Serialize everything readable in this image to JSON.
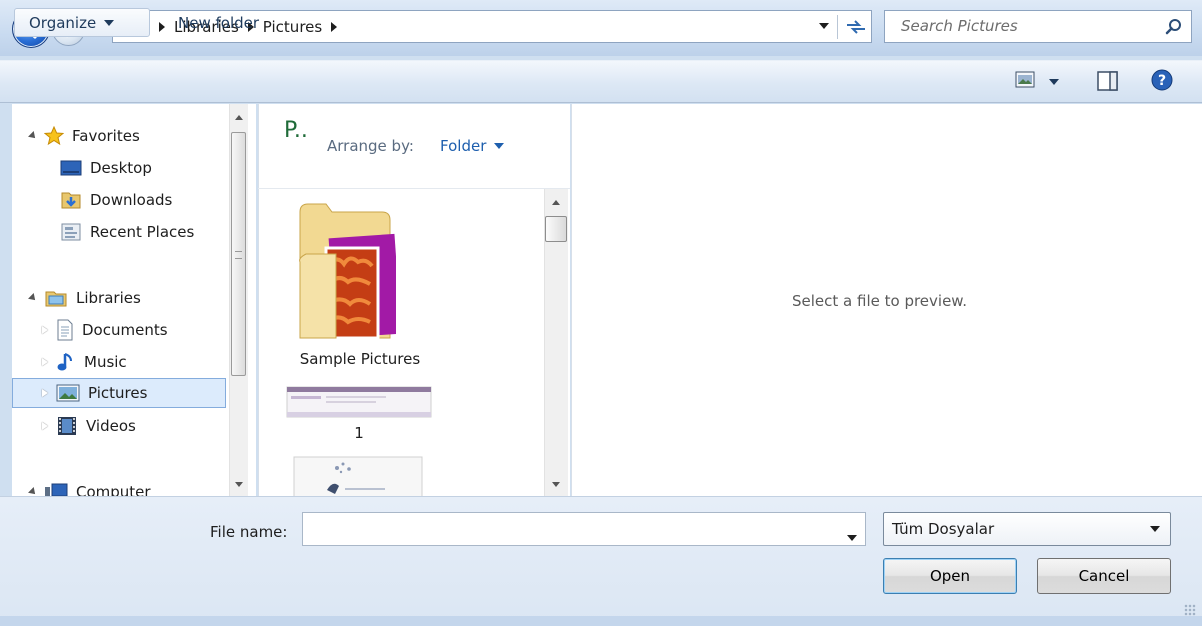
{
  "address": {
    "crumbs": [
      "Libraries",
      "Pictures"
    ]
  },
  "search": {
    "placeholder": "Search Pictures"
  },
  "toolbar": {
    "organize_label": "Organize",
    "new_folder_label": "New folder"
  },
  "nav": {
    "favorites_label": "Favorites",
    "desktop_label": "Desktop",
    "downloads_label": "Downloads",
    "recent_label": "Recent Places",
    "libraries_label": "Libraries",
    "documents_label": "Documents",
    "music_label": "Music",
    "pictures_label": "Pictures",
    "videos_label": "Videos",
    "computer_label": "Computer"
  },
  "file_pane": {
    "library_heading": "P..",
    "arrange_label": "Arrange by:",
    "arrange_value": "Folder",
    "items": [
      {
        "label": "Sample Pictures"
      },
      {
        "label": "1"
      }
    ]
  },
  "preview": {
    "message": "Select a file to preview."
  },
  "bottom": {
    "file_name_label": "File name:",
    "file_name_value": "",
    "file_type_selected": "Tüm Dosyalar",
    "open_label": "Open",
    "cancel_label": "Cancel"
  },
  "colors": {
    "selection": "#dcebfc",
    "link_blue": "#1e5fae",
    "library_green": "#1f6b39"
  }
}
